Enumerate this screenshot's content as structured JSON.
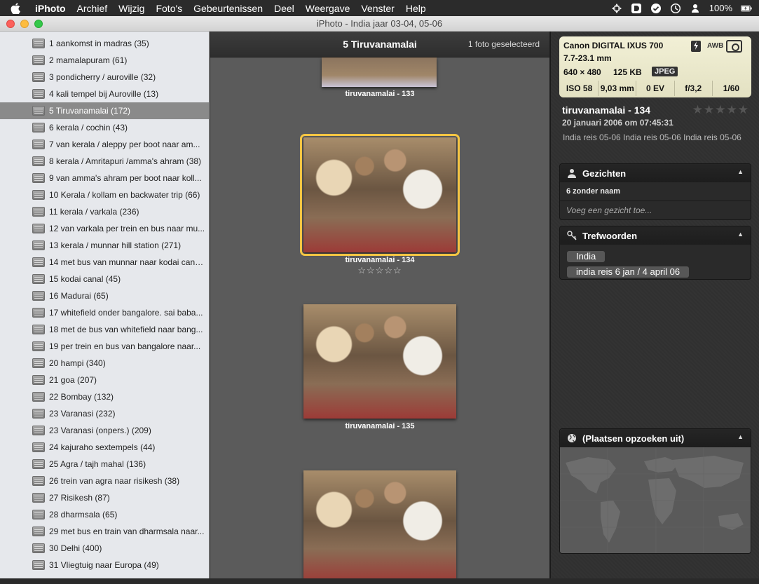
{
  "menubar": {
    "app": "iPhoto",
    "items": [
      "Archief",
      "Wijzig",
      "Foto's",
      "Gebeurtenissen",
      "Deel",
      "Weergave",
      "Venster",
      "Help"
    ],
    "battery": "100%"
  },
  "window": {
    "title": "iPhoto - India jaar 03-04, 05-06"
  },
  "sidebar": {
    "events": [
      {
        "label": "1 aankomst in madras (35)"
      },
      {
        "label": "2 mamalapuram (61)"
      },
      {
        "label": "3 pondicherry / auroville (32)"
      },
      {
        "label": "4 kali tempel bij Auroville (13)"
      },
      {
        "label": "5 Tiruvanamalai (172)"
      },
      {
        "label": "6 kerala / cochin (43)"
      },
      {
        "label": "7 van kerala / aleppy per boot naar am..."
      },
      {
        "label": "8 kerala / Amritapuri /amma's ahram (38)"
      },
      {
        "label": "9 van amma's ahram per boot naar koll..."
      },
      {
        "label": "10 Kerala / kollam en backwater trip (66)"
      },
      {
        "label": "11 kerala / varkala (236)"
      },
      {
        "label": "12 van varkala per trein en bus naar mu..."
      },
      {
        "label": "13 kerala / munnar hill station (271)"
      },
      {
        "label": "14 met bus van munnar naar kodai canal (7)"
      },
      {
        "label": "15 kodai canal (45)"
      },
      {
        "label": "16 Madurai (65)"
      },
      {
        "label": "17 whitefield onder bangalore. sai baba..."
      },
      {
        "label": "18 met de bus van whitefield naar bang..."
      },
      {
        "label": "19 per trein en bus van bangalore naar..."
      },
      {
        "label": "20 hampi (340)"
      },
      {
        "label": "21 goa (207)"
      },
      {
        "label": "22 Bombay (132)"
      },
      {
        "label": "23 Varanasi (232)"
      },
      {
        "label": "23 Varanasi (onpers.) (209)"
      },
      {
        "label": "24 kajuraho sextempels (44)"
      },
      {
        "label": "25 Agra / tajh mahal (136)"
      },
      {
        "label": "26 trein van agra naar risikesh (38)"
      },
      {
        "label": "27 Risikesh (87)"
      },
      {
        "label": "28 dharmsala (65)"
      },
      {
        "label": "29 met bus en train van dharmsala naar..."
      },
      {
        "label": "30 Delhi (400)"
      },
      {
        "label": "31 Vliegtuig naar Europa (49)"
      }
    ],
    "selected_index": 4
  },
  "viewer": {
    "title": "5 Tiruvanamalai",
    "selection_count": "1 foto geselecteerd",
    "photos": [
      {
        "caption": "tiruvanamalai - 133"
      },
      {
        "caption": "tiruvanamalai - 134",
        "rating": "☆☆☆☆☆"
      },
      {
        "caption": "tiruvanamalai - 135"
      }
    ]
  },
  "info": {
    "camera_model": "Canon DIGITAL IXUS 700",
    "lens": "7.7-23.1 mm",
    "resolution": "640 × 480",
    "file_size": "125 KB",
    "format": "JPEG",
    "awb": "AWB",
    "iso": "ISO 58",
    "focal_length": "9,03 mm",
    "exposure_bias": "0 EV",
    "aperture": "f/3,2",
    "shutter": "1/60",
    "photo_title": "tiruvanamalai - 134",
    "photo_rating": "★★★★★",
    "date": "20 januari 2006 om 07:45:31",
    "description": "India reis 05-06 India reis 05-06 India reis 05-06",
    "faces": {
      "heading": "Gezichten",
      "count": "6 zonder naam",
      "add_placeholder": "Voeg een gezicht toe..."
    },
    "keywords": {
      "heading": "Trefwoorden",
      "tags": [
        "India",
        "india reis 6 jan / 4 april 06"
      ]
    },
    "places": {
      "heading": "(Plaatsen opzoeken uit)"
    }
  },
  "colors": {
    "selection_outline": "#f5c543",
    "sidebar_bg": "#e6e8ec",
    "viewer_bg": "#5b5b5b",
    "info_bg": "#303030"
  }
}
